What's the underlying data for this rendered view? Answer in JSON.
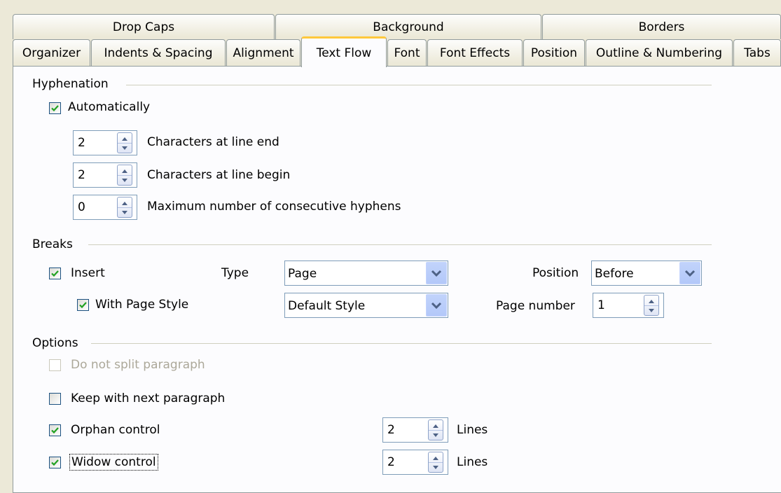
{
  "tabs_row1": [
    "Drop Caps",
    "Background",
    "Borders"
  ],
  "tabs_row2": [
    "Organizer",
    "Indents & Spacing",
    "Alignment",
    "Text Flow",
    "Font",
    "Font Effects",
    "Position",
    "Outline & Numbering",
    "Tabs"
  ],
  "active_tab": "Text Flow",
  "hyphenation": {
    "title": "Hyphenation",
    "automatically": {
      "label": "Automatically",
      "checked": true
    },
    "chars_end": {
      "value": "2",
      "label": "Characters at line end"
    },
    "chars_begin": {
      "value": "2",
      "label": "Characters at line begin"
    },
    "max_hyphens": {
      "value": "0",
      "label": "Maximum number of consecutive hyphens"
    }
  },
  "breaks": {
    "title": "Breaks",
    "insert": {
      "label": "Insert",
      "checked": true
    },
    "type_label": "Type",
    "type_value": "Page",
    "position_label": "Position",
    "position_value": "Before",
    "with_page_style": {
      "label": "With Page Style",
      "checked": true
    },
    "page_style_value": "Default Style",
    "page_number_label": "Page number",
    "page_number_value": "1"
  },
  "options": {
    "title": "Options",
    "do_not_split": {
      "label": "Do not split paragraph",
      "checked": false,
      "disabled": true
    },
    "keep_with_next": {
      "label": "Keep with next paragraph",
      "checked": false
    },
    "orphan": {
      "label": "Orphan control",
      "checked": true,
      "value": "2",
      "unit": "Lines"
    },
    "widow": {
      "label": "Widow control",
      "checked": true,
      "value": "2",
      "unit": "Lines"
    }
  },
  "colors": {
    "dialog_bg": "#ece9d8",
    "panel_bg": "#fcfcfe",
    "active_tab_accent": "#ffc83c",
    "checkmark": "#21a121"
  }
}
